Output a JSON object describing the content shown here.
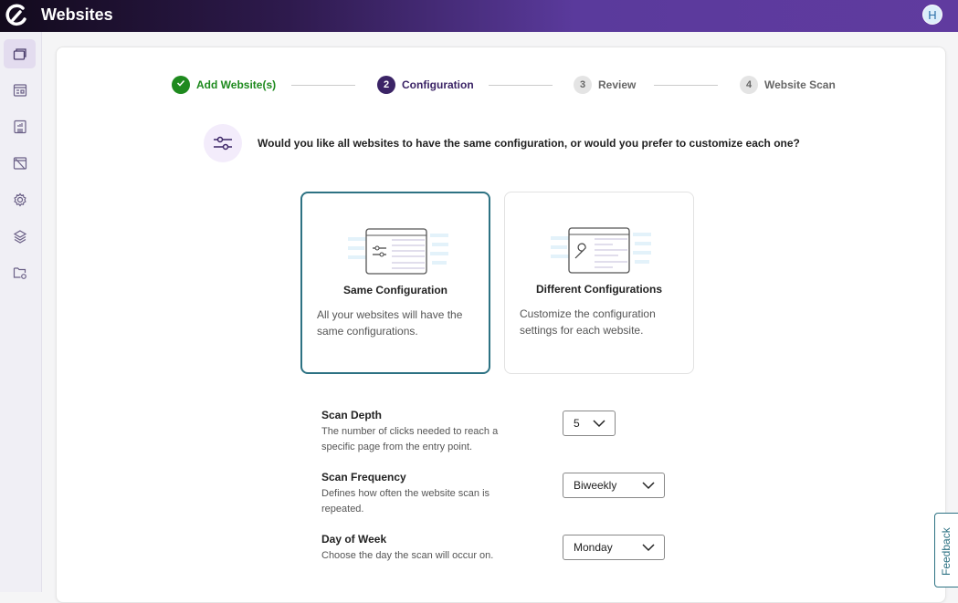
{
  "header": {
    "title": "Websites",
    "avatar_initial": "H"
  },
  "sidebar": {
    "items": [
      "websites-icon",
      "dashboard-icon",
      "reports-icon",
      "broken-window-icon",
      "settings-icon",
      "layers-icon",
      "folder-settings-icon"
    ]
  },
  "stepper": {
    "steps": [
      {
        "num": "1",
        "label": "Add Website(s)",
        "state": "complete"
      },
      {
        "num": "2",
        "label": "Configuration",
        "state": "active"
      },
      {
        "num": "3",
        "label": "Review",
        "state": "pending"
      },
      {
        "num": "4",
        "label": "Website Scan",
        "state": "pending"
      }
    ]
  },
  "question": "Would you like all websites to have the same configuration, or would you prefer to customize each one?",
  "options": [
    {
      "title": "Same Configuration",
      "desc": "All your websites will have the same configurations.",
      "selected": true
    },
    {
      "title": "Different Configurations",
      "desc": "Customize the configuration settings for each website.",
      "selected": false
    }
  ],
  "settings": [
    {
      "label": "Scan Depth",
      "desc": "The number of clicks needed to reach a specific page from the entry point.",
      "value": "5"
    },
    {
      "label": "Scan Frequency",
      "desc": "Defines how often the website scan is repeated.",
      "value": "Biweekly"
    },
    {
      "label": "Day of Week",
      "desc": "Choose the day the scan will occur on.",
      "value": "Monday"
    }
  ],
  "feedback": "Feedback",
  "colors": {
    "accent": "#2d7283",
    "success": "#1e8a1e",
    "primary": "#3b2466"
  }
}
